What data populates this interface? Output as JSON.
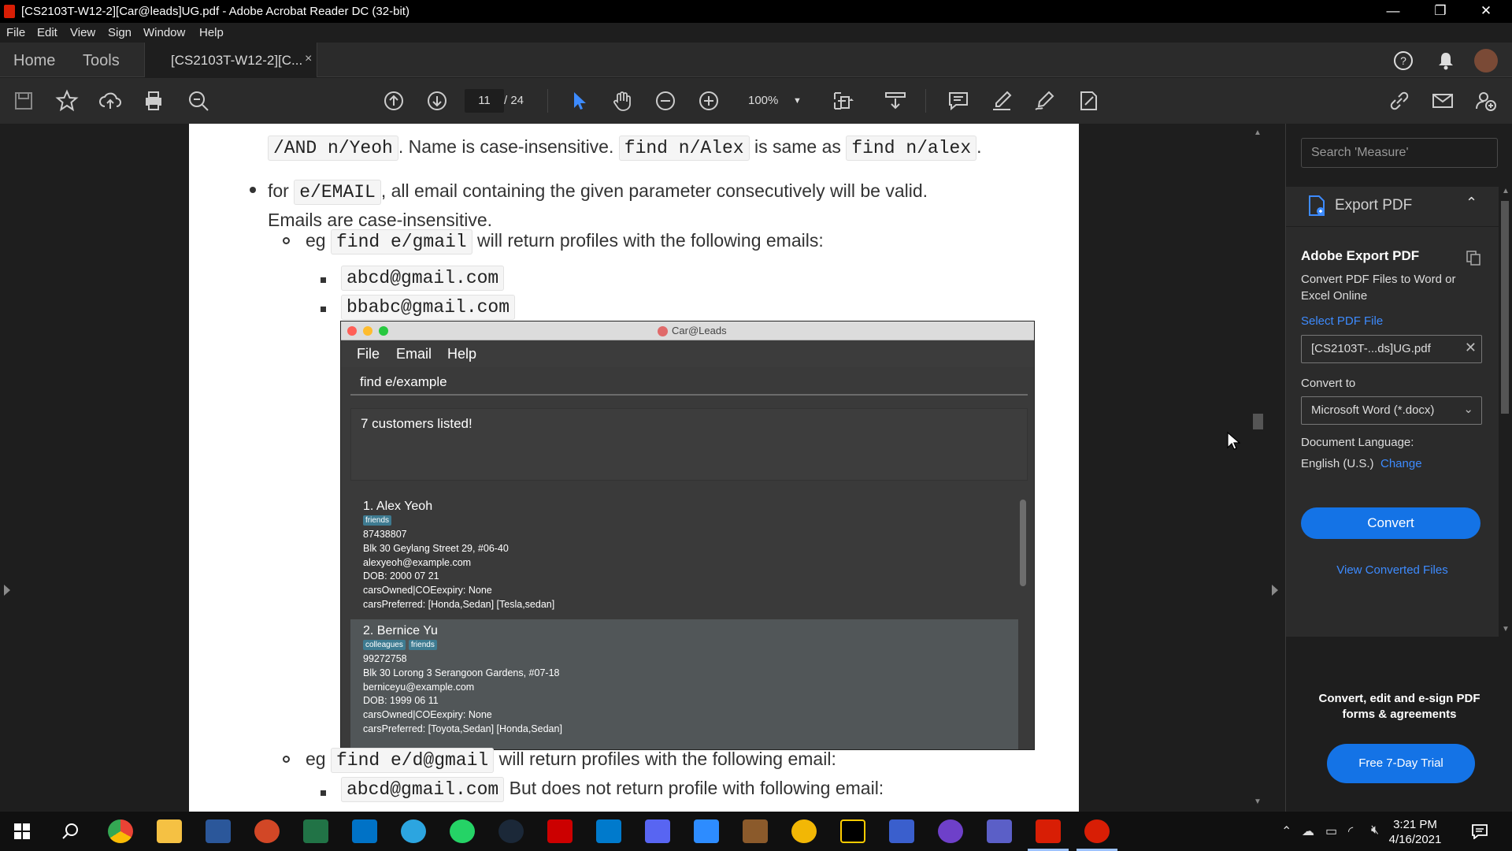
{
  "window": {
    "title": "[CS2103T-W12-2][Car@leads]UG.pdf - Adobe Acrobat Reader DC (32-bit)",
    "minimize": "—",
    "restore": "❐",
    "close": "✕"
  },
  "menu": [
    "File",
    "Edit",
    "View",
    "Sign",
    "Window",
    "Help"
  ],
  "tabs": {
    "home": "Home",
    "tools": "Tools",
    "document": "[CS2103T-W12-2][C...",
    "close": "×"
  },
  "toolbar": {
    "page_current": "11",
    "page_total": "/ 24",
    "zoom": "100%"
  },
  "document": {
    "line1": {
      "code1": "/AND n/Yeoh",
      "t1": ". Name is case-insensitive.",
      "code2": "find n/Alex",
      "t2": "is same as",
      "code3": "find n/alex",
      "t3": "."
    },
    "line2": {
      "t1": "for",
      "code1": "e/EMAIL",
      "t2": ", all email containing the given parameter consecutively will be valid."
    },
    "line3": "Emails are case-insensitive.",
    "line4": {
      "t1": "eg",
      "code1": "find e/gmail",
      "t2": "will return profiles with the following emails:"
    },
    "line5": "abcd@gmail.com",
    "line6": "bbabc@gmail.com",
    "line7": {
      "t1": "eg",
      "code1": "find e/d@gmail",
      "t2": "will return profiles with the following email:"
    },
    "line8": {
      "code1": "abcd@gmail.com",
      "t1": "But does not return profile with following email:"
    }
  },
  "embedded_app": {
    "title": "Car@Leads",
    "menu": [
      "File",
      "Email",
      "Help"
    ],
    "command": "find e/example",
    "result": "7 customers listed!",
    "customers": [
      {
        "name": "1.  Alex Yeoh",
        "tags": [
          "friends"
        ],
        "phone": "87438807",
        "address": "Blk 30 Geylang Street 29, #06-40",
        "email": "alexyeoh@example.com",
        "dob": "DOB: 2000 07 21",
        "cars_owned": "carsOwned|COEexpiry: None",
        "cars_preferred": "carsPreferred: [Honda,Sedan] [Tesla,sedan]"
      },
      {
        "name": "2.  Bernice Yu",
        "tags": [
          "colleagues",
          "friends"
        ],
        "phone": "99272758",
        "address": "Blk 30 Lorong 3 Serangoon Gardens, #07-18",
        "email": "berniceyu@example.com",
        "dob": "DOB: 1999 06 11",
        "cars_owned": "carsOwned|COEexpiry: None",
        "cars_preferred": "carsPreferred: [Toyota,Sedan] [Honda,Sedan]"
      }
    ]
  },
  "right_panel": {
    "search_placeholder": "Search 'Measure'",
    "export_label": "Export PDF",
    "heading": "Adobe Export PDF",
    "description": "Convert PDF Files to Word or Excel Online",
    "select_file": "Select PDF File",
    "file_name": "[CS2103T-...ds]UG.pdf",
    "convert_to": "Convert to",
    "convert_format": "Microsoft Word (*.docx)",
    "doc_language_label": "Document Language:",
    "doc_language": "English (U.S.)",
    "change": "Change",
    "convert_button": "Convert",
    "view_converted": "View Converted Files",
    "promo": "Convert, edit and e-sign PDF forms & agreements",
    "trial_button": "Free 7-Day Trial"
  },
  "taskbar": {
    "time": "3:21 PM",
    "date": "4/16/2021"
  }
}
